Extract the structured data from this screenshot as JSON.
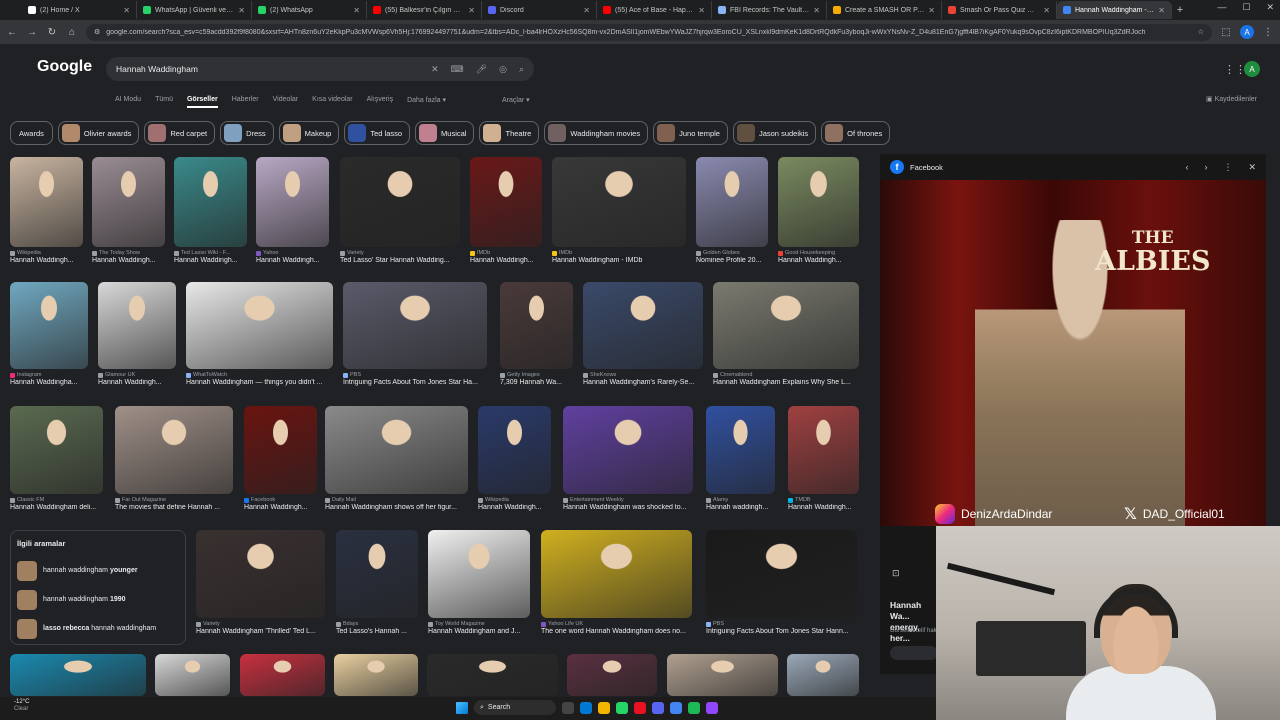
{
  "browser": {
    "tabs": [
      {
        "label": "(2) Home / X",
        "color": "#ffffff"
      },
      {
        "label": "WhatsApp | Güvenli ve Güven",
        "color": "#25d366"
      },
      {
        "label": "(2) WhatsApp",
        "color": "#25d366"
      },
      {
        "label": "(55) Balkesir'in Çılgın Eşekleri",
        "color": "#ff0000"
      },
      {
        "label": "Discord",
        "color": "#5865f2"
      },
      {
        "label": "(55) Ace of Base - Happy Na",
        "color": "#ff0000"
      },
      {
        "label": "FBI Records: The Vault — Jeffr",
        "color": "#8ab4f8"
      },
      {
        "label": "Create a SMASH OR PASS W",
        "color": "#f9ab00"
      },
      {
        "label": "Smash Or Pass Quiz Game Rx",
        "color": "#ea4335"
      },
      {
        "label": "Hannah Waddingham - Goog",
        "color": "#4285f4"
      }
    ],
    "url": "google.com/search?sca_esv=c59acdd392f9f8080&sxsrf=AHTn8zn6uY2eKkpPu3cMVWsp6Vh5Hj:1769924497751&udm=2&tbs=ADc_l-ba4lrHOXzHc56SQ8m-vx2DmASIl1jomWEbwYWaJZ7hjrqw3EoroCU_XSLnxkl9dmKeK1d8DrtRQdkFu3yboqJi-wWxYNsNv-Z_D4u81EnG7jgfft4lB7iKgAF0Yukq9sOvpC8zI6iptKDRMBOPIUq3ZdRJoch"
  },
  "google": {
    "logo": "Google",
    "query": "Hannah Waddingham",
    "nav_tabs": [
      "AI Modu",
      "Tümü",
      "Görseller",
      "Haberler",
      "Videolar",
      "Kısa videolar",
      "Alışveriş",
      "Daha fazla"
    ],
    "active_tab": "Görseller",
    "tools_label": "Araçlar",
    "saved_label": "Kaydedilenler",
    "avatar_letter": "A"
  },
  "chips": [
    {
      "label": "Awards",
      "thumb": null
    },
    {
      "label": "Olivier awards",
      "thumb": "#b08a6a"
    },
    {
      "label": "Red carpet",
      "thumb": "#a07070"
    },
    {
      "label": "Dress",
      "thumb": "#80a0c0"
    },
    {
      "label": "Makeup",
      "thumb": "#c0a080"
    },
    {
      "label": "Ted lasso",
      "thumb": "#3050a0"
    },
    {
      "label": "Musical",
      "thumb": "#c08090"
    },
    {
      "label": "Theatre",
      "thumb": "#d0b090"
    },
    {
      "label": "Waddingham movies",
      "thumb": "#706060"
    },
    {
      "label": "Juno temple",
      "thumb": "#806050"
    },
    {
      "label": "Jason sudeikis",
      "thumb": "#605040"
    },
    {
      "label": "Of thrones",
      "thumb": "#907060"
    }
  ],
  "images_rows": [
    [
      {
        "src": "Wikipedia",
        "cap": "Hannah Waddingh...",
        "color": "#c8b4a0",
        "src_color": "#9aa0a6"
      },
      {
        "src": "The Today Show",
        "cap": "Hannah Waddingh...",
        "color": "#9a8c94",
        "src_color": "#9aa0a6"
      },
      {
        "src": "Ted Lasso Wiki - F...",
        "cap": "Hannah Waddingh...",
        "color": "#3a8a8a",
        "src_color": "#9aa0a6"
      },
      {
        "src": "Yahoo",
        "cap": "Hannah Waddingh...",
        "color": "#b8a8c4",
        "src_color": "#7e57c2"
      },
      {
        "src": "Variety",
        "cap": "Ted Lasso' Star Hannah Wadding...",
        "color": "#2a2a2a",
        "src_color": "#9aa0a6"
      },
      {
        "src": "IMDb",
        "cap": "Hannah Waddingh...",
        "color": "#6a1818",
        "src_color": "#f5c518"
      },
      {
        "src": "IMDb",
        "cap": "Hannah Waddingham - IMDb",
        "color": "#383838",
        "src_color": "#f5c518"
      },
      {
        "src": "Golden Globes",
        "cap": "Nominee Profile 20...",
        "color": "#8a8ab0",
        "src_color": "#9aa0a6"
      },
      {
        "src": "Good Housekeeping",
        "cap": "Hannah Waddingh...",
        "color": "#7a8a60",
        "src_color": "#ea4335"
      }
    ],
    [
      {
        "src": "Instagram",
        "cap": "Hannah Waddingha...",
        "color": "#70a8c0",
        "src_color": "#ee2a7b"
      },
      {
        "src": "Glamour UK",
        "cap": "Hannah Waddingh...",
        "color": "#d8d8d8",
        "src_color": "#9aa0a6"
      },
      {
        "src": "WhatToWatch",
        "cap": "Hannah Waddingham — things you didn't ...",
        "color": "#e8e8e8",
        "src_color": "#8ab4f8"
      },
      {
        "src": "PBS",
        "cap": "Intriguing Facts About Tom Jones Star Ha...",
        "color": "#5a5a6a",
        "src_color": "#8ab4f8"
      },
      {
        "src": "Getty Images",
        "cap": "7,309 Hannah Wa...",
        "color": "#4a3a3a",
        "src_color": "#9aa0a6"
      },
      {
        "src": "SheKnows",
        "cap": "Hannah Waddingham's Rarely-Se...",
        "color": "#3a4a6a",
        "src_color": "#9aa0a6"
      },
      {
        "src": "Cinemablend",
        "cap": "Hannah Waddingham Explains Why She L...",
        "color": "#7a7a70",
        "src_color": "#9aa0a6"
      }
    ],
    [
      {
        "src": "Classic FM",
        "cap": "Hannah Waddingham deli...",
        "color": "#5a6a50",
        "src_color": "#9aa0a6"
      },
      {
        "src": "Far Out Magazine",
        "cap": "The movies that define Hannah ...",
        "color": "#a09088",
        "src_color": "#9aa0a6"
      },
      {
        "src": "Facebook",
        "cap": "Hannah Waddingh...",
        "color": "#6a1410",
        "src_color": "#1877f2"
      },
      {
        "src": "Daily Mail",
        "cap": "Hannah Waddingham shows off her figur...",
        "color": "#8a8a8a",
        "src_color": "#9aa0a6"
      },
      {
        "src": "Wikipedia",
        "cap": "Hannah Waddingh...",
        "color": "#2a3a6a",
        "src_color": "#9aa0a6"
      },
      {
        "src": "Entertainment Weekly",
        "cap": "Hannah Waddingham was shocked to...",
        "color": "#6040a0",
        "src_color": "#9aa0a6"
      },
      {
        "src": "Alamy",
        "cap": "Hannah waddingh...",
        "color": "#3050a0",
        "src_color": "#9aa0a6"
      },
      {
        "src": "TMDB",
        "cap": "Hannah Waddingh...",
        "color": "#a04040",
        "src_color": "#01b4e4"
      }
    ],
    [
      {
        "src": "Variety",
        "cap": "Hannah Waddingham 'Thrilled' Ted L...",
        "color": "#3a3030",
        "src_color": "#9aa0a6"
      },
      {
        "src": "Bdays",
        "cap": "Ted Lasso's Hannah ...",
        "color": "#2a3040",
        "src_color": "#9aa0a6"
      },
      {
        "src": "Toy World Magazine",
        "cap": "Hannah Waddingham and J...",
        "color": "#f0f0f0",
        "src_color": "#9aa0a6"
      },
      {
        "src": "Yahoo Life UK",
        "cap": "The one word Hannah Waddingham does no...",
        "color": "#d0b020",
        "src_color": "#7e57c2"
      },
      {
        "src": "PBS",
        "cap": "Intriguing Facts About Tom Jones Star Hann...",
        "color": "#1a1a1a",
        "src_color": "#8ab4f8"
      }
    ],
    [
      {
        "src": "",
        "cap": "",
        "color": "#1a8ab0"
      },
      {
        "src": "",
        "cap": "",
        "color": "#d8d8d8"
      },
      {
        "src": "",
        "cap": "",
        "color": "#c83040"
      },
      {
        "src": "",
        "cap": "",
        "color": "#e8d0a0"
      },
      {
        "src": "",
        "cap": "",
        "color": "#2a2a2a"
      },
      {
        "src": "",
        "cap": "",
        "color": "#5a3040"
      },
      {
        "src": "",
        "cap": "",
        "color": "#b0a090"
      },
      {
        "src": "",
        "cap": "",
        "color": "#9aa8b8"
      }
    ]
  ],
  "related": {
    "title": "İlgili aramalar",
    "items": [
      {
        "text": "hannah waddingham ",
        "bold": "younger"
      },
      {
        "text": "hannah waddingham ",
        "bold": "1990"
      },
      {
        "text": "hannah waddingham",
        "bold": "lasso rebecca ",
        "bold_first": true
      }
    ]
  },
  "preview": {
    "site": "Facebook",
    "sign_line1": "THE",
    "sign_line2": "ALBIES",
    "handle_ig": "DenizArdaDindar",
    "handle_x": "DAD_Official01",
    "title": "Hannah Wa... energy, her...",
    "subtitle": "Görseller telif hak..."
  },
  "taskbar": {
    "temp": "-12°C",
    "condition": "Clear",
    "search_label": "Search"
  }
}
